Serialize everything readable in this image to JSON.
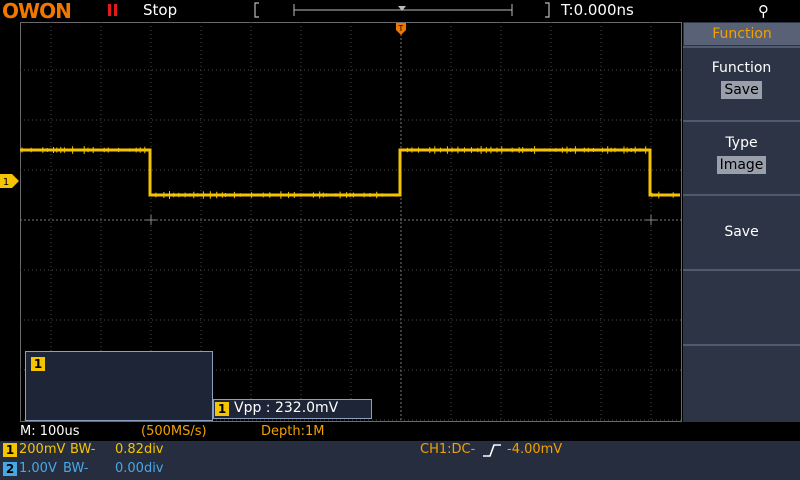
{
  "brand": {
    "logo": "OWON"
  },
  "status": {
    "run_state": "Stop",
    "trigger_time": "T:0.000ns"
  },
  "colors": {
    "ch1": "#f5c400",
    "ch2": "#47a8e8",
    "accent": "#f3a000",
    "brand": "#f07800",
    "grid": "#5c5c5c"
  },
  "icons": [
    "pause-icon",
    "usb-icon",
    "trigger-position-icon",
    "ch1-level-icon"
  ],
  "ch1_window": {
    "badge": "1"
  },
  "measurement": {
    "badge": "1",
    "text": "Vpp : 232.0mV"
  },
  "menu": {
    "header": "Function",
    "items": [
      {
        "label": "Function",
        "value": "Save"
      },
      {
        "label": "Type",
        "value": "Image"
      },
      {
        "label": "Save"
      }
    ]
  },
  "bottom": {
    "timebase": "M: 100us",
    "sample_rate": "(500MS/s)",
    "depth": "Depth:1M",
    "ch1": {
      "badge": "1",
      "scale": "200mV",
      "bw": "BW-",
      "offset": "0.82div"
    },
    "ch2": {
      "badge": "2",
      "scale": "1.00V",
      "bw": "BW-",
      "offset": "0.00div"
    },
    "trigger": {
      "prefix": "CH1:DC-",
      "level": "-4.00mV"
    }
  },
  "chart_data": {
    "type": "line",
    "series": [
      {
        "values_div": [
          0.2,
          0.2,
          -0.7,
          -0.7,
          0.2,
          0.2,
          -0.7,
          -0.7
        ],
        "x_div": [
          0,
          2.6,
          2.6,
          7.6,
          7.6,
          12.6,
          12.6,
          13.2
        ]
      }
    ]
  }
}
